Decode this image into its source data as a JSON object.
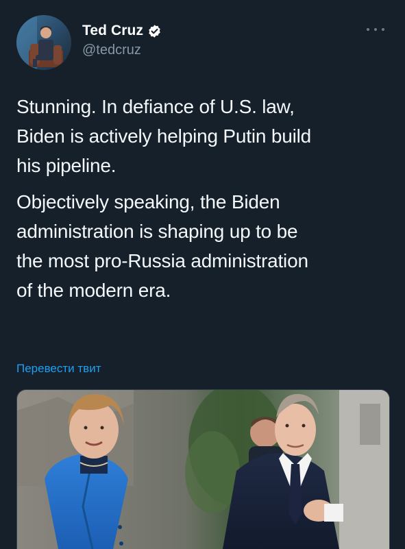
{
  "tweet": {
    "author": {
      "display_name": "Ted Cruz",
      "handle": "@tedcruz",
      "verified": true
    },
    "paragraphs": [
      "Stunning. In defiance of U.S. law,\nBiden is actively helping Putin build\nhis pipeline.",
      "Objectively speaking, the Biden\nadministration is shaping up to be\nthe most pro-Russia administration\nof the modern era."
    ],
    "translate_label": "Перевести твит",
    "media": {
      "kind": "photo",
      "description_icon": "photo-thumbnail"
    }
  },
  "icons": {
    "verified": "verified-badge-icon",
    "more": "more-dots-icon"
  },
  "colors": {
    "background": "#15202b",
    "link": "#1da1f2",
    "secondary_text": "#8899a6",
    "primary_text": "#ffffff"
  }
}
